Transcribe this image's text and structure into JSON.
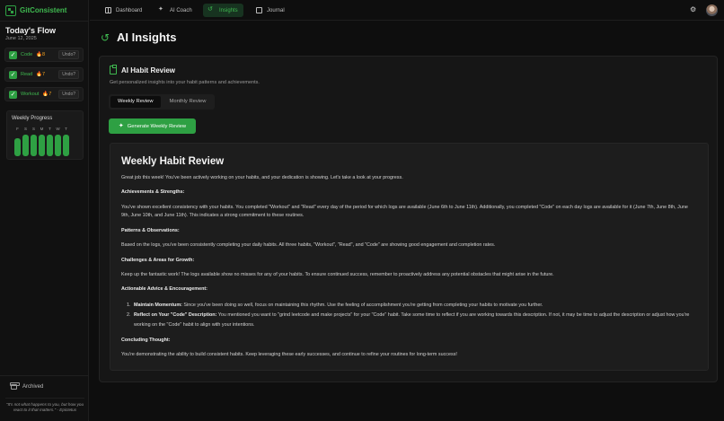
{
  "app": {
    "name": "GitConsistent"
  },
  "sidebar": {
    "title": "Today's Flow",
    "date": "June 12, 2025",
    "habits": [
      {
        "name": "Code",
        "streak": "8",
        "undo_label": "Undo?"
      },
      {
        "name": "Read",
        "streak": "7",
        "undo_label": "Undo?"
      },
      {
        "name": "Workout",
        "streak": "7",
        "undo_label": "Undo?"
      }
    ],
    "weekly_progress": {
      "title": "Weekly Progress",
      "days": [
        "F",
        "S",
        "S",
        "M",
        "T",
        "W",
        "T"
      ],
      "completion": [
        0.85,
        1,
        1,
        1,
        1,
        1,
        1
      ]
    },
    "archived_label": "Archived",
    "quote": "\"It's not what happens to you, but how you react to it that matters.\" - Epictetus"
  },
  "nav": {
    "items": [
      {
        "label": "Dashboard",
        "icon": "dashboard-icon"
      },
      {
        "label": "AI Coach",
        "icon": "sparkles-icon"
      },
      {
        "label": "Insights",
        "icon": "insights-icon",
        "active": true
      },
      {
        "label": "Journal",
        "icon": "journal-icon"
      }
    ]
  },
  "page": {
    "title": "AI Insights"
  },
  "review": {
    "card_title": "AI Habit Review",
    "card_subtitle": "Get personalized insights into your habit patterns and achievements.",
    "tabs": [
      {
        "label": "Weekly Review",
        "active": true
      },
      {
        "label": "Monthly Review",
        "active": false
      }
    ],
    "generate_label": "Generate Weekly Review",
    "output": {
      "title": "Weekly Habit Review",
      "intro": "Great job this week! You've been actively working on your habits, and your dedication is showing. Let's take a look at your progress.",
      "h_achievements": "Achievements & Strengths:",
      "p_achievements": "You've shown excellent consistency with your habits. You completed \"Workout\" and \"Read\" every day of the period for which logs are available (June 6th to June 11th). Additionally, you completed \"Code\" on each day logs are available for it (June 7th, June 8th, June 9th, June 10th, and June 11th). This indicates a strong commitment to these routines.",
      "h_patterns": "Patterns & Observations:",
      "p_patterns": "Based on the logs, you've been consistently completing your daily habits. All three habits, \"Workout\", \"Read\", and \"Code\" are showing good engagement and completion rates.",
      "h_challenges": "Challenges & Areas for Growth:",
      "p_challenges": "Keep up the fantastic work! The logs available show no misses for any of your habits. To ensure continued success, remember to proactively address any potential obstacles that might arise in the future.",
      "h_advice": "Actionable Advice & Encouragement:",
      "advice": [
        {
          "lead": "Maintain Momentum:",
          "text": " Since you've been doing so well, focus on maintaining this rhythm. Use the feeling of accomplishment you're getting from completing your habits to motivate you further."
        },
        {
          "lead": "Reflect on Your \"Code\" Description:",
          "text": " You mentioned you want to \"grind leetcode and make projects\" for your \"Code\" habit. Take some time to reflect if you are working towards this description. If not, it may be time to adjust the description or adjust how you're working on the \"Code\" habit to align with your intentions."
        }
      ],
      "h_concluding": "Concluding Thought:",
      "p_concluding": "You're demonstrating the ability to build consistent habits. Keep leveraging these early successes, and continue to refine your routines for long-term success!"
    }
  },
  "colors": {
    "accent": "#2ea043",
    "accent_text": "#3fb950",
    "streak": "#f0a020",
    "background": "#0e0e0e"
  }
}
